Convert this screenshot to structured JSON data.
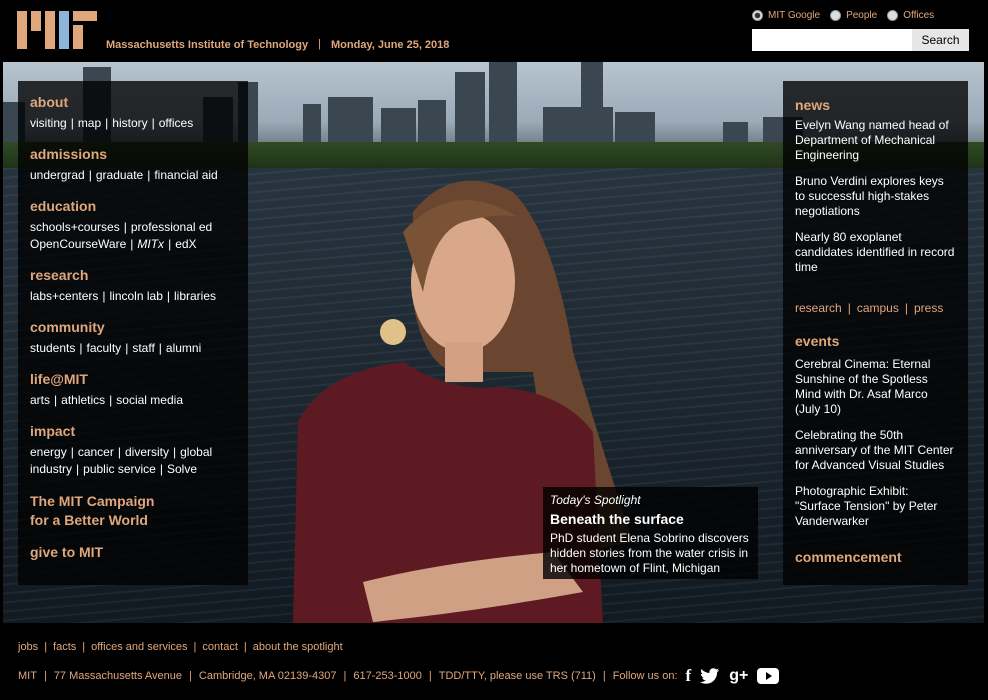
{
  "header": {
    "logo": "mit-logo",
    "site_title": "Massachusetts Institute of Technology",
    "separator": "|",
    "date": "Monday, June 25, 2018"
  },
  "search": {
    "options": [
      {
        "label": "MIT Google",
        "checked": true
      },
      {
        "label": "People",
        "checked": false
      },
      {
        "label": "Offices",
        "checked": false
      }
    ],
    "input_value": "",
    "button_label": "Search"
  },
  "left_nav": {
    "about": {
      "heading": "about",
      "links": [
        "visiting",
        "map",
        "history",
        "offices"
      ]
    },
    "admissions": {
      "heading": "admissions",
      "links": [
        "undergrad",
        "graduate",
        "financial aid"
      ]
    },
    "education": {
      "heading": "education",
      "links_row1": [
        "schools+courses",
        "professional ed"
      ],
      "links_row2": [
        "OpenCourseWare",
        "MITx",
        "edX"
      ]
    },
    "research": {
      "heading": "research",
      "links": [
        "labs+centers",
        "lincoln lab",
        "libraries"
      ]
    },
    "community": {
      "heading": "community",
      "links": [
        "students",
        "faculty",
        "staff",
        "alumni"
      ]
    },
    "life": {
      "heading": "life@MIT",
      "links": [
        "arts",
        "athletics",
        "social media"
      ]
    },
    "impact": {
      "heading": "impact",
      "links_row1": [
        "energy",
        "cancer",
        "diversity",
        "global"
      ],
      "links_row2": [
        "industry",
        "public service",
        "Solve"
      ]
    },
    "campaign_line1": "The MIT Campaign",
    "campaign_line2": "for a Better World",
    "give": "give to MIT"
  },
  "news": {
    "heading": "news",
    "items": [
      "Evelyn Wang named head of Department of Mechanical Engineering",
      "Bruno Verdini explores keys to successful high-stakes negotiations",
      "Nearly 80 exoplanet candidates identified in record time"
    ],
    "links": [
      "research",
      "campus",
      "press"
    ]
  },
  "events": {
    "heading": "events",
    "items": [
      "Cerebral Cinema: Eternal Sunshine of the Spotless Mind with Dr. Asaf Marco (July 10)",
      "Celebrating the 50th anniversary of the MIT Center for Advanced Visual Studies",
      "Photographic Exhibit: \"Surface Tension\" by Peter Vanderwarker"
    ]
  },
  "commencement": "commencement",
  "spotlight": {
    "label": "Today's Spotlight",
    "title": "Beneath the surface",
    "description": "PhD student Elena Sobrino discovers hidden stories from the water crisis in her hometown of Flint, Michigan"
  },
  "footer": {
    "nav": [
      "jobs",
      "facts",
      "offices and services",
      "contact",
      "about the spotlight"
    ],
    "info": [
      "MIT",
      "77 Massachusetts Avenue",
      "Cambridge, MA 02139-4307",
      "617-253-1000",
      "TDD/TTY, please use TRS (711)"
    ],
    "follow_label": "Follow us on:",
    "social": [
      {
        "icon": "facebook-icon",
        "glyph": "f"
      },
      {
        "icon": "twitter-icon",
        "glyph": "🐦"
      },
      {
        "icon": "google-plus-icon",
        "glyph": "g+"
      },
      {
        "icon": "youtube-icon",
        "glyph": "▶"
      }
    ]
  },
  "colors": {
    "accent": "#e0a77c",
    "background": "#000000",
    "text": "#ffffff"
  }
}
